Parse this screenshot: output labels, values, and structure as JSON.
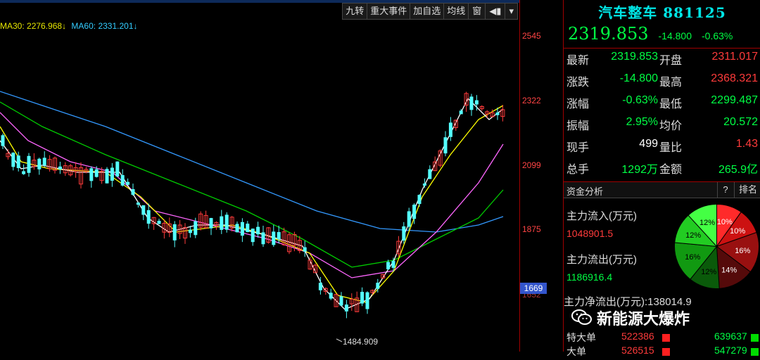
{
  "toolbar": {
    "items": [
      "九转",
      "重大事件",
      "加自选",
      "均线",
      "窗"
    ]
  },
  "indicators": {
    "ma30": "MA30: 2276.968↓",
    "ma60": "MA60: 2331.201↓"
  },
  "chart_labels": {
    "low_annotation": "1484.909"
  },
  "axis": {
    "ticks": [
      "2545",
      "2322",
      "2099",
      "1875",
      "1669",
      "1652"
    ]
  },
  "header": {
    "name": "汽车整车",
    "code": "881125",
    "price": "2319.853",
    "change": "-14.800",
    "change_pct": "-0.63%"
  },
  "quote": [
    {
      "label1": "最新",
      "value1": "2319.853",
      "label2": "开盘",
      "value2": "2311.017"
    },
    {
      "label1": "涨跌",
      "value1": "-14.800",
      "label2": "最高",
      "value2": "2368.321"
    },
    {
      "label1": "涨幅",
      "value1": "-0.63%",
      "label2": "最低",
      "value2": "2299.487"
    },
    {
      "label1": "振幅",
      "value1": "2.95%",
      "label2": "均价",
      "value2": "20.572"
    },
    {
      "label1": "现手",
      "value1": "499",
      "label2": "量比",
      "value2": "1.43"
    },
    {
      "label1": "总手",
      "value1": "1292万",
      "label2": "金额",
      "value2": "265.9亿"
    }
  ],
  "capital": {
    "title": "资金分析",
    "help": "?",
    "rank": "排名",
    "inflow_label": "主力流入(万元)",
    "inflow_value": "1048901.5",
    "outflow_label": "主力流出(万元)",
    "outflow_value": "1186916.4",
    "net_label": "主力净流出(万元):",
    "net_value": "138014.9",
    "pie": [
      "10%",
      "10%",
      "16%",
      "14%",
      "12%",
      "16%",
      "12%",
      "12%"
    ]
  },
  "watermark": "新能源大爆炸",
  "big_orders": [
    {
      "label": "特大单",
      "v1": "522386",
      "v2": "639637"
    },
    {
      "label": "大单",
      "v1": "526515",
      "v2": "547279"
    }
  ],
  "colors": {
    "up": "#ff3b3b",
    "down": "#00ff44",
    "candle_down": "#54ffff",
    "ma5": "#ffffff",
    "ma10": "#ffff00",
    "ma20": "#ff66ff",
    "ma30": "#00cc00",
    "ma60": "#3399ff"
  }
}
